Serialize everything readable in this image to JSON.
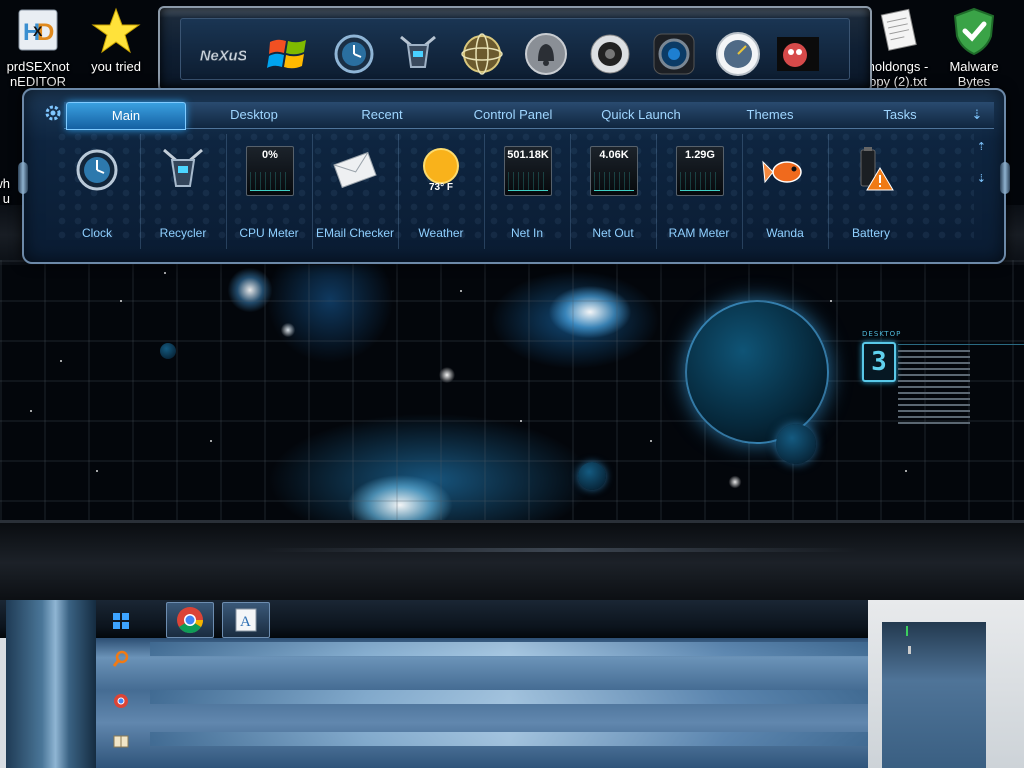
{
  "desktop_icons": [
    {
      "id": "hxd",
      "label_line1": "prdSEXnot",
      "label_line2": "nEDITOR"
    },
    {
      "id": "you-tried",
      "label_line1": "you tried",
      "label_line2": ""
    },
    {
      "id": "holdongs",
      "label_line1": "holdongs -",
      "label_line2": "opy (2).txt"
    },
    {
      "id": "malware",
      "label_line1": "Malware",
      "label_line2": "Bytes"
    }
  ],
  "left_partial_labels": [
    "wh",
    "u"
  ],
  "dock": {
    "items": [
      "nexus-logo",
      "windows-logo",
      "clock-globe",
      "recycler-robot",
      "network-globe",
      "bell",
      "speaker",
      "camera",
      "speedometer",
      "game-character"
    ],
    "logo_text": "NeXuS"
  },
  "launcher": {
    "tabs": [
      "Main",
      "Desktop",
      "Recent",
      "Control Panel",
      "Quick Launch",
      "Themes",
      "Tasks"
    ],
    "active_tab": "Main",
    "slots": [
      {
        "label": "Clock",
        "icon": "clock-icon"
      },
      {
        "label": "Recycler",
        "icon": "recycler-icon"
      },
      {
        "label": "CPU Meter",
        "icon": "cpu-meter-icon",
        "value": "0%"
      },
      {
        "label": "EMail Checker",
        "icon": "email-icon"
      },
      {
        "label": "Weather",
        "icon": "weather-sun-icon",
        "value": "73° F"
      },
      {
        "label": "Net In",
        "icon": "net-in-icon",
        "value": "501.18K"
      },
      {
        "label": "Net Out",
        "icon": "net-out-icon",
        "value": "4.06K"
      },
      {
        "label": "RAM Meter",
        "icon": "ram-meter-icon",
        "value": "1.29G"
      },
      {
        "label": "Wanda",
        "icon": "goldfish-icon"
      },
      {
        "label": "Battery",
        "icon": "battery-warning-icon"
      }
    ]
  },
  "hud": {
    "label": "DESKTOP",
    "number": "3"
  },
  "taskbar": {
    "buttons": [
      "windows-start",
      "chrome",
      "file-manager"
    ]
  },
  "colors": {
    "accent": "#3aa0e0",
    "label": "#8fd0ff",
    "panel": "#0e2540"
  }
}
